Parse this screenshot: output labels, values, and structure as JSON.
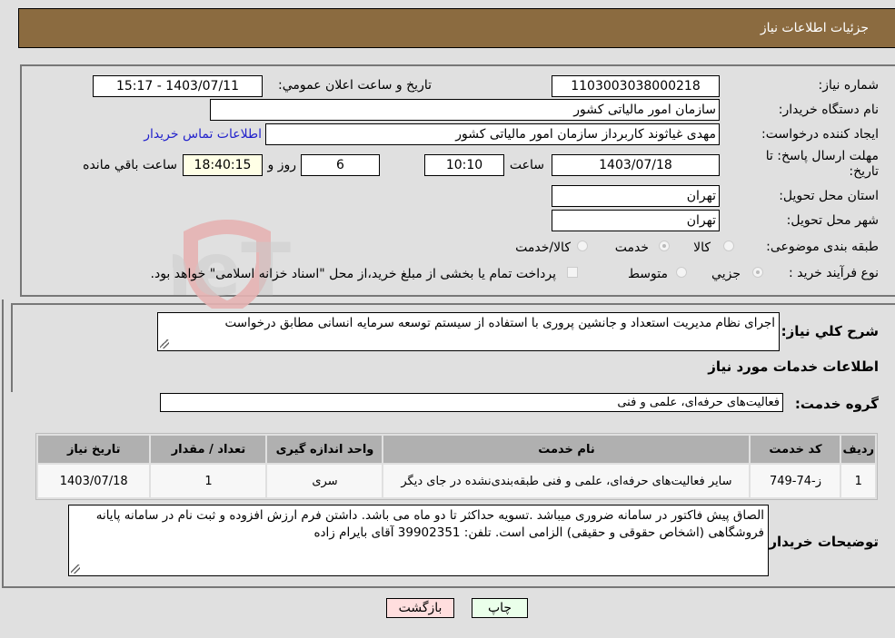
{
  "header": {
    "title": "جزئیات اطلاعات نیاز"
  },
  "form": {
    "need_number": {
      "label": "شماره نیاز:",
      "value": "1103003038000218"
    },
    "announce_datetime": {
      "label": "تاریخ و ساعت اعلان عمومي:",
      "value": "1403/07/11 - 15:17"
    },
    "buyer_org": {
      "label": "نام دستگاه خريدار:",
      "value": "سازمان امور مالیاتی کشور"
    },
    "requester": {
      "label": "ایجاد کننده درخواست:",
      "value": "مهدی غیاثوند کاربرداز سازمان امور مالیاتی کشور"
    },
    "buyer_contact_link": "اطلاعات تماس خريدار",
    "deadline": {
      "label": "مهلت ارسال پاسخ: تا تاریخ:",
      "date": "1403/07/18",
      "time_label": "ساعت",
      "time": "10:10",
      "days": "6",
      "days_label": "روز و",
      "remaining": "18:40:15",
      "remaining_label": "ساعت باقي مانده"
    },
    "province": {
      "label": "استان محل تحویل:",
      "value": "تهران"
    },
    "city": {
      "label": "شهر محل تحویل:",
      "value": "تهران"
    },
    "category": {
      "label": "طبقه بندی موضوعی:",
      "options": [
        "کالا",
        "خدمت",
        "کالا/خدمت"
      ],
      "selected": "خدمت"
    },
    "purchase_type": {
      "label": "نوع فرآیند خرید :",
      "options": [
        "جزيي",
        "متوسط"
      ],
      "selected": "جزيي",
      "treasury_checkbox_label": "پرداخت تمام یا بخشی از مبلغ خرید،از محل \"اسناد خزانه اسلامی\" خواهد بود.",
      "treasury_checked": false
    }
  },
  "description": {
    "label": "شرح کلي نياز:",
    "value": "اجرای نظام مدیریت استعداد و جانشین پروری با استفاده از سیستم توسعه سرمایه انسانی مطابق درخواست"
  },
  "services_section": {
    "title": "اطلاعات خدمات مورد نیاز",
    "group_label": "گروه خدمت:",
    "group_value": "فعالیت‌های حرفه‌ای، علمی و فنی"
  },
  "table": {
    "headers": [
      "رديف",
      "کد خدمت",
      "نام خدمت",
      "واحد اندازه گیری",
      "تعداد / مقدار",
      "تاریخ نیاز"
    ],
    "rows": [
      [
        "1",
        "ز-74-749",
        "سایر فعالیت‌های حرفه‌ای، علمی و فنی طبقه‌بندی‌نشده در جای دیگر",
        "سری",
        "1",
        "1403/07/18"
      ]
    ]
  },
  "buyer_notes": {
    "label": "توضيحات خريدار:",
    "value": "الصاق پیش فاکتور در سامانه ضروری میباشد .تسویه حداکثر تا دو ماه می باشد.  داشتن فرم ارزش افزوده و ثبت نام در سامانه پایانه فروشگاهی (اشخاص حقوقی و حقیقی) الزامی است. تلفن:  39902351 آقای بایرام زاده"
  },
  "buttons": {
    "print": "چاپ",
    "back": "بازگشت"
  },
  "colors": {
    "header_bg": "#8b6b40",
    "print_bg": "#eaffea",
    "back_bg": "#ffdede",
    "link": "#2222cc"
  },
  "watermark": {
    "text": "AriaTender.neT"
  }
}
